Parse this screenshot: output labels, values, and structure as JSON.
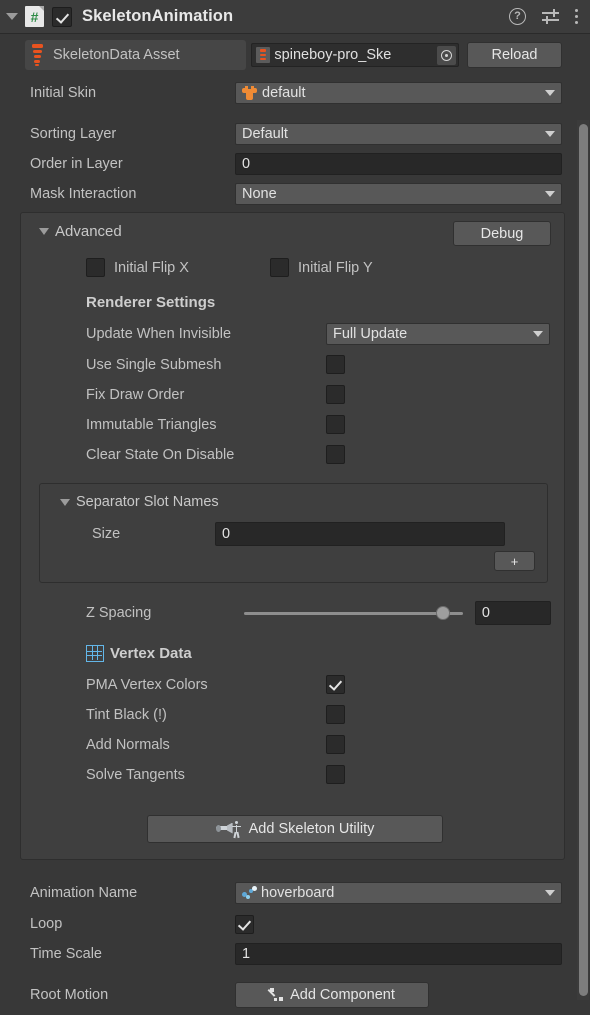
{
  "header": {
    "title": "SkeletonAnimation",
    "enabled_checkbox": true,
    "script_icon": "csharp-script-icon",
    "script_icon_glyph": "#",
    "foldout_expanded": true,
    "icons": [
      {
        "name": "help-icon",
        "glyph": "?"
      },
      {
        "name": "preset-sliders-icon"
      },
      {
        "name": "more-options-icon"
      }
    ]
  },
  "skeleton_data": {
    "label": "SkeletonData Asset",
    "asset_value": "spineboy-pro_Ske",
    "reload_label": "Reload",
    "picker_icon": "object-picker-icon"
  },
  "fields": {
    "initial_skin": {
      "label": "Initial Skin",
      "value": "default",
      "icon": "skin-icon"
    },
    "sorting_layer": {
      "label": "Sorting Layer",
      "value": "Default"
    },
    "order_in_layer": {
      "label": "Order in Layer",
      "value": "0"
    },
    "mask_interaction": {
      "label": "Mask Interaction",
      "value": "None"
    }
  },
  "advanced": {
    "title": "Advanced",
    "expanded": true,
    "debug_label": "Debug",
    "initial_flip_x": {
      "label": "Initial Flip X",
      "checked": false
    },
    "initial_flip_y": {
      "label": "Initial Flip Y",
      "checked": false
    },
    "renderer_settings_title": "Renderer Settings",
    "update_when_invisible": {
      "label": "Update When Invisible",
      "value": "Full Update"
    },
    "toggles": [
      {
        "label": "Use Single Submesh",
        "checked": false
      },
      {
        "label": "Fix Draw Order",
        "checked": false
      },
      {
        "label": "Immutable Triangles",
        "checked": false
      },
      {
        "label": "Clear State On Disable",
        "checked": false
      }
    ],
    "separator_slot_names": {
      "title": "Separator Slot Names",
      "expanded": true,
      "size_label": "Size",
      "size_value": "0",
      "add_label": "+"
    },
    "z_spacing": {
      "label": "Z Spacing",
      "value": "0",
      "knob_percent": 91
    },
    "vertex_data": {
      "title": "Vertex Data",
      "icon": "vertex-grid-icon",
      "toggles": [
        {
          "label": "PMA Vertex Colors",
          "checked": true
        },
        {
          "label": "Tint Black  (!)",
          "checked": false
        },
        {
          "label": "Add Normals",
          "checked": false
        },
        {
          "label": "Solve Tangents",
          "checked": false
        }
      ]
    },
    "add_skeleton_utility": {
      "label": "Add Skeleton Utility",
      "icon": "skeleton-utility-icon"
    }
  },
  "animation": {
    "animation_name": {
      "label": "Animation Name",
      "value": "hoverboard",
      "icon": "animation-icon"
    },
    "loop": {
      "label": "Loop",
      "checked": true
    },
    "time_scale": {
      "label": "Time Scale",
      "value": "1"
    },
    "root_motion": {
      "label": "Root Motion",
      "button_label": "Add Component",
      "icon": "add-component-icon"
    }
  },
  "colors": {
    "background": "#383838",
    "header_bg": "#3c3c3c",
    "group_bg": "#3f3f3f",
    "field_bg": "#282828",
    "popup_bg": "#585858",
    "accent_orange": "#e8531f",
    "accent_blue": "#63b6e8",
    "text": "#c2c2c2"
  }
}
